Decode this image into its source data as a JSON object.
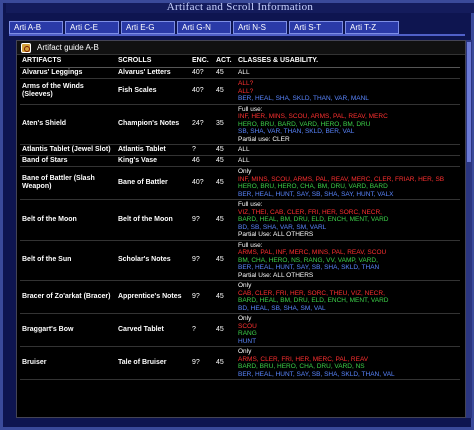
{
  "window": {
    "title": "Artifact and Scroll Information"
  },
  "tabs": [
    "Arti A-B",
    "Arti C-E",
    "Arti E-G",
    "Arti G-N",
    "Arti N-S",
    "Arti S-T",
    "Arti T-Z"
  ],
  "guide": {
    "label": "Artifact guide A-B"
  },
  "columns": [
    "ARTIFACTS",
    "SCROLLS",
    "ENC.",
    "ACT.",
    "CLASSES & USABILITY."
  ],
  "rows": [
    {
      "artifact": "Alvarus' Leggings",
      "scroll": "Alvarus' Letters",
      "enc": "40?",
      "act": "45",
      "classes": [
        {
          "t": "ALL",
          "c": "white"
        }
      ]
    },
    {
      "artifact": "Arms of the Winds (Sleeves)",
      "scroll": "Fish Scales",
      "enc": "40?",
      "act": "45",
      "classes": [
        {
          "t": "ALL?",
          "c": "red"
        },
        {
          "t": "ALL?",
          "c": "red"
        },
        {
          "t": "BER, HEAL, SHA, SKLD, THAN, VAR, MANL",
          "c": "blue"
        }
      ]
    },
    {
      "artifact": "Aten's Shield",
      "scroll": "Champion's Notes",
      "enc": "24?",
      "act": "35",
      "classes": [
        {
          "t": "Full use:",
          "c": "white"
        },
        {
          "t": "INF, HER, MINS, SCOU, ARMS, PAL, REAV, MERC",
          "c": "red"
        },
        {
          "t": "HERO, BRU, BARD, VARD, HERO, BM, DRU",
          "c": "green"
        },
        {
          "t": "SB, SHA, VAR, THAN, SKLD, BER, VAL",
          "c": "blue"
        },
        {
          "t": "Partial use: CLER",
          "c": "white"
        }
      ]
    },
    {
      "artifact": "Atlantis Tablet (Jewel Slot)",
      "scroll": "Atlantis Tablet",
      "enc": "?",
      "act": "45",
      "classes": [
        {
          "t": "ALL",
          "c": "white"
        }
      ]
    },
    {
      "artifact": "Band of Stars",
      "scroll": "King's Vase",
      "enc": "46",
      "act": "45",
      "classes": [
        {
          "t": "ALL",
          "c": "white"
        }
      ]
    },
    {
      "artifact": "Bane of Battler (Slash Weapon)",
      "scroll": "Bane of Battler",
      "enc": "40?",
      "act": "45",
      "classes": [
        {
          "t": "Only",
          "c": "white"
        },
        {
          "t": "INF, MINS, SCOU, ARMS, PAL, REAV, MERC, CLER, FRIAR, HER, SB",
          "c": "red"
        },
        {
          "t": "HERO, BRU, HERO, CHA, BM, DRU, VARD, BARD",
          "c": "green"
        },
        {
          "t": "BER, HEAL, HUNT, SAY, SB, SHA, SAY, HUNT, VALX",
          "c": "blue"
        }
      ]
    },
    {
      "artifact": "Belt of the Moon",
      "scroll": "Belt of the Moon",
      "enc": "9?",
      "act": "45",
      "classes": [
        {
          "t": "Full use:",
          "c": "white"
        },
        {
          "t": "VIZ, THEI, CAB, CLER, FRI, HER, SORC, NECR,",
          "c": "red"
        },
        {
          "t": "BARD, HEAL, BM, DRU, ELD, ENCH, MENT, VARD",
          "c": "green"
        },
        {
          "t": "BD, SB, SHA, VAR, SM, VARL",
          "c": "blue"
        },
        {
          "t": "Partial Use: ALL OTHERS",
          "c": "white"
        }
      ]
    },
    {
      "artifact": "Belt of the Sun",
      "scroll": "Scholar's Notes",
      "enc": "9?",
      "act": "45",
      "classes": [
        {
          "t": "Full use:",
          "c": "white"
        },
        {
          "t": "ARMS, PAL, INF, MERC, MINS, PAL, REAV, SCOU",
          "c": "red"
        },
        {
          "t": "BM, CHA, HERO, NS, RANG, VV, VAMP, VARD,",
          "c": "green"
        },
        {
          "t": "BER, HEAL, HUNT, SAY, SB, SHA, SKLD, THAN",
          "c": "blue"
        },
        {
          "t": "Partial Use: ALL OTHERS",
          "c": "white"
        }
      ]
    },
    {
      "artifact": "Bracer of Zo'arkat (Bracer)",
      "scroll": "Apprentice's Notes",
      "enc": "9?",
      "act": "45",
      "classes": [
        {
          "t": "Only",
          "c": "white"
        },
        {
          "t": "CAB, CLER, FRI, HER, SORC, THEU, VIZ, NECR,",
          "c": "red"
        },
        {
          "t": "BARD, HEAL, BM, DRU, ELD, ENCH, MENT, VARD",
          "c": "green"
        },
        {
          "t": "BD, HEAL, SB, SHA, SM, VAL",
          "c": "blue"
        }
      ]
    },
    {
      "artifact": "Braggart's Bow",
      "scroll": "Carved Tablet",
      "enc": "?",
      "act": "45",
      "classes": [
        {
          "t": "Only",
          "c": "white"
        },
        {
          "t": "SCOU",
          "c": "red"
        },
        {
          "t": "RANG",
          "c": "green"
        },
        {
          "t": "HUNT",
          "c": "blue"
        }
      ]
    },
    {
      "artifact": "Bruiser",
      "scroll": "Tale of Bruiser",
      "enc": "9?",
      "act": "45",
      "classes": [
        {
          "t": "Only",
          "c": "white"
        },
        {
          "t": "ARMS, CLER, FRI, HER, MERC, PAL, REAV",
          "c": "red"
        },
        {
          "t": "BARD, BRU, HERO, CHA, DRU, VARD, NS",
          "c": "green"
        },
        {
          "t": "BER, HEAL, HUNT, SAY, SB, SHA, SKLD, THAN, VAL",
          "c": "blue"
        }
      ]
    }
  ]
}
